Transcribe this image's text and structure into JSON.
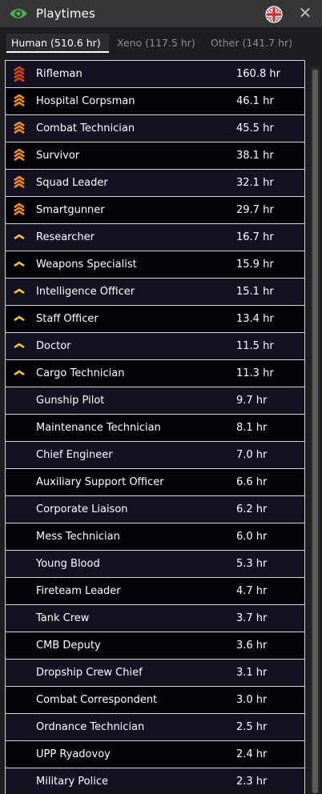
{
  "window": {
    "title": "Playtimes",
    "icon": "eye-icon",
    "flag_icon": "union-jack-icon",
    "close_icon": "close-icon"
  },
  "tabs": [
    {
      "label": "Human (510.6 hr)",
      "active": true
    },
    {
      "label": "Xeno (117.5 hr)",
      "active": false
    },
    {
      "label": "Other (141.7 hr)",
      "active": false
    }
  ],
  "rows": [
    {
      "name": "Rifleman",
      "hours": "160.8 hr",
      "rank": "red-chevrons"
    },
    {
      "name": "Hospital Corpsman",
      "hours": "46.1 hr",
      "rank": "orange-chevrons"
    },
    {
      "name": "Combat Technician",
      "hours": "45.5 hr",
      "rank": "orange-chevrons"
    },
    {
      "name": "Survivor",
      "hours": "38.1 hr",
      "rank": "orange-chevrons"
    },
    {
      "name": "Squad Leader",
      "hours": "32.1 hr",
      "rank": "orange-chevrons"
    },
    {
      "name": "Smartgunner",
      "hours": "29.7 hr",
      "rank": "orange-chevrons"
    },
    {
      "name": "Researcher",
      "hours": "16.7 hr",
      "rank": "yellow-chevron"
    },
    {
      "name": "Weapons Specialist",
      "hours": "15.9 hr",
      "rank": "yellow-chevron"
    },
    {
      "name": "Intelligence Officer",
      "hours": "15.1 hr",
      "rank": "yellow-chevron"
    },
    {
      "name": "Staff Officer",
      "hours": "13.4 hr",
      "rank": "yellow-chevron"
    },
    {
      "name": "Doctor",
      "hours": "11.5 hr",
      "rank": "yellow-chevron"
    },
    {
      "name": "Cargo Technician",
      "hours": "11.3 hr",
      "rank": "yellow-chevron"
    },
    {
      "name": "Gunship Pilot",
      "hours": "9.7 hr",
      "rank": "none"
    },
    {
      "name": "Maintenance Technician",
      "hours": "8.1 hr",
      "rank": "none"
    },
    {
      "name": "Chief Engineer",
      "hours": "7.0 hr",
      "rank": "none"
    },
    {
      "name": "Auxiliary Support Officer",
      "hours": "6.6 hr",
      "rank": "none"
    },
    {
      "name": "Corporate Liaison",
      "hours": "6.2 hr",
      "rank": "none"
    },
    {
      "name": "Mess Technician",
      "hours": "6.0 hr",
      "rank": "none"
    },
    {
      "name": "Young Blood",
      "hours": "5.3 hr",
      "rank": "none"
    },
    {
      "name": "Fireteam Leader",
      "hours": "4.7 hr",
      "rank": "none"
    },
    {
      "name": "Tank Crew",
      "hours": "3.7 hr",
      "rank": "none"
    },
    {
      "name": "CMB Deputy",
      "hours": "3.6 hr",
      "rank": "none"
    },
    {
      "name": "Dropship Crew Chief",
      "hours": "3.1 hr",
      "rank": "none"
    },
    {
      "name": "Combat Correspondent",
      "hours": "3.0 hr",
      "rank": "none"
    },
    {
      "name": "Ordnance Technician",
      "hours": "2.5 hr",
      "rank": "none"
    },
    {
      "name": "UPP Ryadovoy",
      "hours": "2.4 hr",
      "rank": "none"
    },
    {
      "name": "Military Police",
      "hours": "2.3 hr",
      "rank": "none"
    }
  ],
  "colors": {
    "titlebar": "#363636",
    "eye": "#4caf50",
    "rank_red": "#d9441f",
    "rank_orange": "#f08a2c",
    "rank_yellow": "#f4c232"
  }
}
